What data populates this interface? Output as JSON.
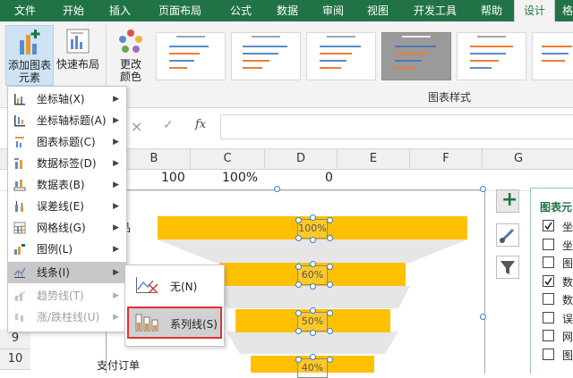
{
  "ribbon_tabs": [
    "文件",
    "开始",
    "插入",
    "页面布局",
    "公式",
    "数据",
    "审阅",
    "视图",
    "开发工具",
    "帮助",
    "设计",
    "格式"
  ],
  "ribbon": {
    "add_element_line1": "添加图表",
    "add_element_line2": "元素",
    "quick_layout": "快速布局",
    "change_colors_line1": "更改",
    "change_colors_line2": "颜色",
    "styles_group": "图表样式"
  },
  "formula_bar": {
    "cancel": "×",
    "confirm": "✓",
    "fx": "fx"
  },
  "columns": [
    "B",
    "C",
    "D",
    "E",
    "F",
    "G"
  ],
  "rows": [
    "9",
    "10"
  ],
  "cells": {
    "b": "100",
    "c": "100%",
    "d": "0",
    "label1": "商品",
    "label2": "支付订单"
  },
  "chart_data": {
    "type": "bar",
    "categories": [
      "商品",
      "",
      "",
      "支付订单"
    ],
    "values": [
      100,
      60,
      50,
      40
    ],
    "data_labels": [
      "100%",
      "60%",
      "50%",
      "40%"
    ],
    "title": ""
  },
  "menu": {
    "items": [
      {
        "label": "坐标轴(X)",
        "enabled": true
      },
      {
        "label": "坐标轴标题(A)",
        "enabled": true
      },
      {
        "label": "图表标题(C)",
        "enabled": true
      },
      {
        "label": "数据标签(D)",
        "enabled": true
      },
      {
        "label": "数据表(B)",
        "enabled": true
      },
      {
        "label": "误差线(E)",
        "enabled": true
      },
      {
        "label": "网格线(G)",
        "enabled": true
      },
      {
        "label": "图例(L)",
        "enabled": true
      },
      {
        "label": "线条(I)",
        "enabled": true
      },
      {
        "label": "趋势线(T)",
        "enabled": false
      },
      {
        "label": "涨/跌柱线(U)",
        "enabled": false
      }
    ],
    "arrow": "▶"
  },
  "submenu": {
    "none": "无(N)",
    "series_lines": "系列线(S)"
  },
  "side_panel": {
    "plus": "+",
    "title": "图表元",
    "items": [
      {
        "label": "坐",
        "checked": true
      },
      {
        "label": "坐",
        "checked": false
      },
      {
        "label": "图",
        "checked": false
      },
      {
        "label": "数",
        "checked": true
      },
      {
        "label": "数",
        "checked": false
      },
      {
        "label": "误",
        "checked": false
      },
      {
        "label": "网",
        "checked": false
      },
      {
        "label": "图",
        "checked": false
      }
    ]
  },
  "colors": {
    "excel_green": "#217346",
    "bar": "#ffc000",
    "highlight_red": "#e03131"
  }
}
